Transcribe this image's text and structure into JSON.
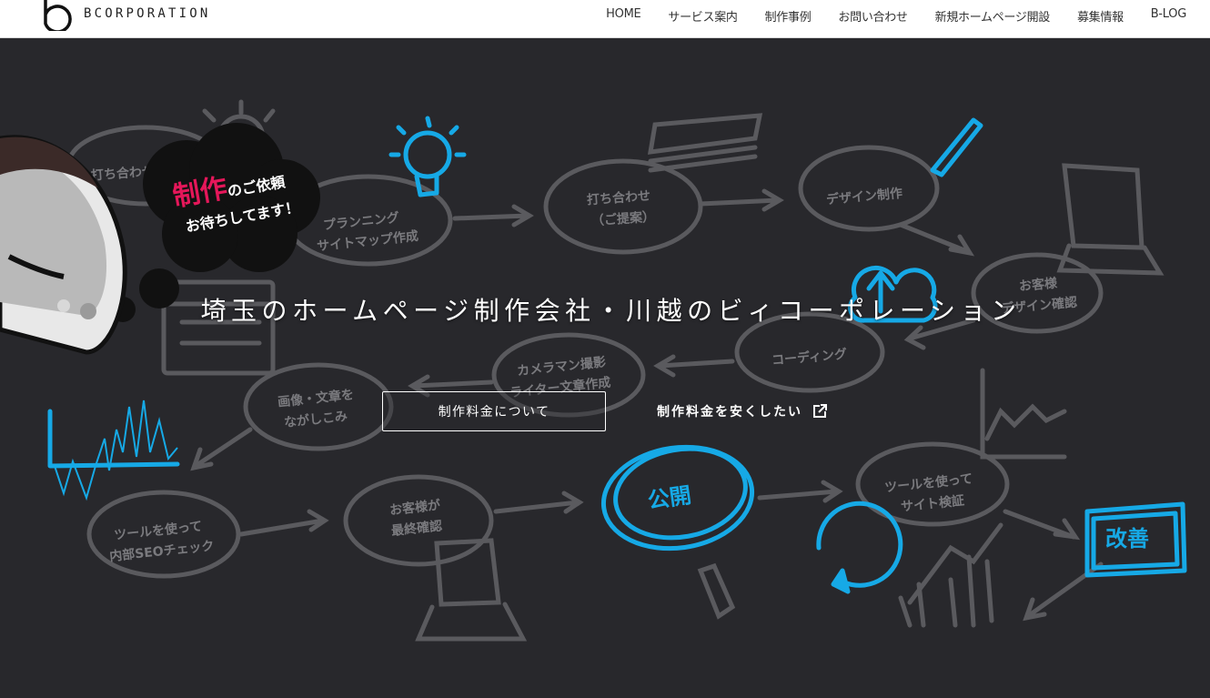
{
  "brand": {
    "name": "BCORPORATION"
  },
  "nav": [
    "HOME",
    "サービス案内",
    "制作事例",
    "お問い合わせ",
    "新規ホームページ開設",
    "募集情報",
    "B-LOG"
  ],
  "hero": {
    "headline": "埼玉のホームページ制作会社・川越のビィコーポレーション",
    "bubble": {
      "emphasis": "制作",
      "line1_rest": "のご依頼",
      "line2": "お待ちしてます！"
    },
    "primary_button": "制作料金について",
    "secondary_link": "制作料金を安くしたい"
  },
  "flow": {
    "steps": [
      "打ち合わせ",
      "プランニング",
      "サイトマップ作成",
      "打ち合わせ",
      "（ご提案）",
      "デザイン制作",
      "お客様",
      "デザイン確認",
      "コーディング",
      "カメラマン撮影",
      "ライター文章作成",
      "画像・文章を",
      "ながしこみ",
      "ツールを使って",
      "内部SEOチェック",
      "お客様が",
      "最終確認",
      "公開",
      "ツールを使って",
      "サイト検証",
      "改善"
    ]
  },
  "colors": {
    "accent": "#16a9e6",
    "pink": "#e5175a",
    "bg": "#28282c",
    "sketch": "#5a5a5e"
  }
}
